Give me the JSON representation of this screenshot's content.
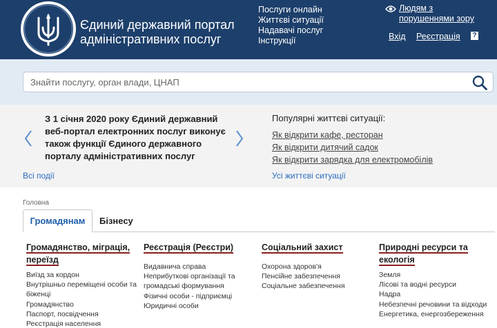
{
  "header": {
    "title": "Єдиний державний портал адміністративних послуг",
    "nav": [
      "Послуги онлайн",
      "Життєві ситуації",
      "Надавачі послуг",
      "Інструкції"
    ],
    "accessibility_label": "Людям з порушеннями зору",
    "login_label": "Вхід",
    "register_label": "Реєстрація",
    "help_label": "?"
  },
  "search": {
    "placeholder": "Знайти послугу, орган влади, ЦНАП"
  },
  "news": {
    "text_bold": "З 1 січня 2020 року",
    "text_rest": " Єдиний державний веб-портал електронних послуг виконує також функції Єдиного державного порталу адміністративних послуг",
    "all_events_label": "Всі події"
  },
  "popular": {
    "title": "Популярні життєві ситуації:",
    "items": [
      "Як відкрити кафе, ресторан",
      "Як відкрити дитячий садок",
      "Як відкрити зарядка для електромобілів"
    ],
    "all_label": "Усі життєві ситуації"
  },
  "breadcrumb": "Головна",
  "tabs": [
    "Громадянам",
    "Бізнесу"
  ],
  "categories": [
    {
      "title": "Громадянство, міграція, переїзд",
      "items": [
        "Виїзд за кордон",
        "Внутрішньо переміщені особи та біженці",
        "Громадянство",
        "Паспорт, посвідчення",
        "Реєстрація населення"
      ]
    },
    {
      "title": "Реєстрація (Реєстри)",
      "items": [
        "Видавнича справа",
        "Неприбуткові організації та громадські формування",
        "Фізичні особи - підприємці",
        "Юридичні особи"
      ]
    },
    {
      "title": "Соціальний захист",
      "items": [
        "Охорона здоров'я",
        "Пенсійне забезпечення",
        "Соціальне забезпечення"
      ]
    },
    {
      "title": "Природні ресурси та екологія",
      "items": [
        "Земля",
        "Лісові та водні ресурси",
        "Надра",
        "Небезпечні речовини та відходи",
        "Енергетика, енергозбереження"
      ]
    }
  ],
  "colors": {
    "header_bg": "#1d3f6b",
    "search_band_bg": "#e2ebf4",
    "news_band_bg": "#f3f3f3",
    "link_blue": "#2a6bbf",
    "category_underline": "#8a1f1f"
  },
  "icons": [
    "trident-emblem-icon",
    "eye-icon",
    "search-icon",
    "chevron-left-icon",
    "chevron-right-icon",
    "help-icon"
  ]
}
